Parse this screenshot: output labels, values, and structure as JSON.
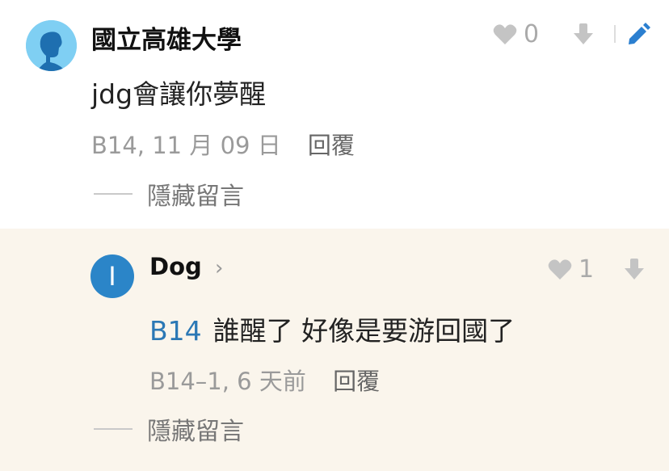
{
  "comment": {
    "author": "國立高雄大學",
    "likes": "0",
    "text": "jdg會讓你夢醒",
    "meta": "B14, 11 月 09 日",
    "reply_label": "回覆",
    "hide_label": "隱藏留言"
  },
  "reply": {
    "avatar_letter": "I",
    "author": "Dog",
    "likes": "1",
    "floor_tag": "B14",
    "text": "誰醒了 好像是要游回國了",
    "meta": "B14–1, 6 天前",
    "reply_label": "回覆",
    "hide_label": "隱藏留言"
  },
  "icons": {
    "heart": "heart-icon",
    "down": "arrow-down-icon",
    "edit": "pencil-icon",
    "chevron": "chevron-right-icon"
  },
  "colors": {
    "reply_bg": "#faf5ec",
    "link_blue": "#2b78b5",
    "edit_blue": "#2b7fd0",
    "avatar_blue": "#2b85c8",
    "avatar_light": "#7fcff3"
  }
}
